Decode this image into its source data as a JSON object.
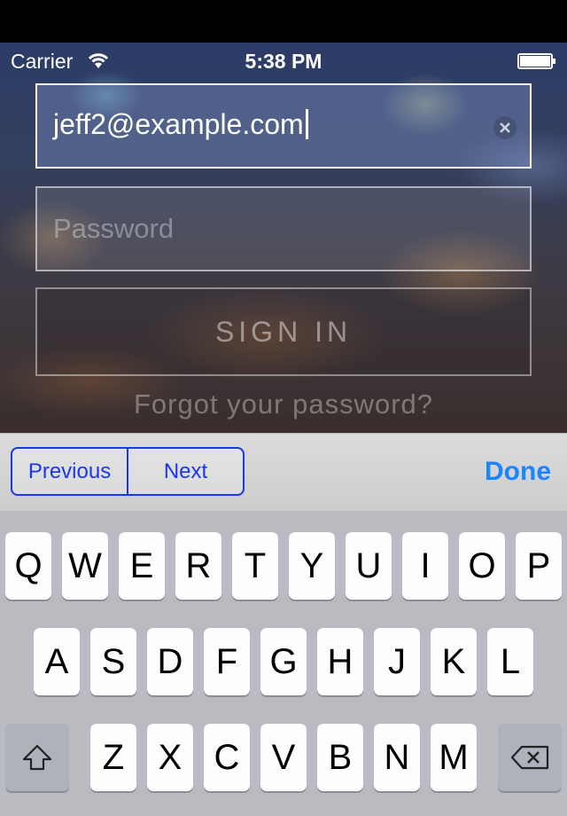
{
  "status_bar": {
    "carrier": "Carrier",
    "time": "5:38 PM"
  },
  "login": {
    "email_value": "jeff2@example.com",
    "password_placeholder": "Password",
    "signin_label": "SIGN IN",
    "forgot_label": "Forgot your password?"
  },
  "accessory": {
    "previous_label": "Previous",
    "next_label": "Next",
    "done_label": "Done"
  },
  "keyboard": {
    "row1": [
      "Q",
      "W",
      "E",
      "R",
      "T",
      "Y",
      "U",
      "I",
      "O",
      "P"
    ],
    "row2": [
      "A",
      "S",
      "D",
      "F",
      "G",
      "H",
      "J",
      "K",
      "L"
    ],
    "row3": [
      "Z",
      "X",
      "C",
      "V",
      "B",
      "N",
      "M"
    ],
    "shift_icon": "shift-icon",
    "backspace_icon": "backspace-icon"
  },
  "colors": {
    "accent_blue": "#1a85ff",
    "segment_blue": "#1b35f0"
  }
}
